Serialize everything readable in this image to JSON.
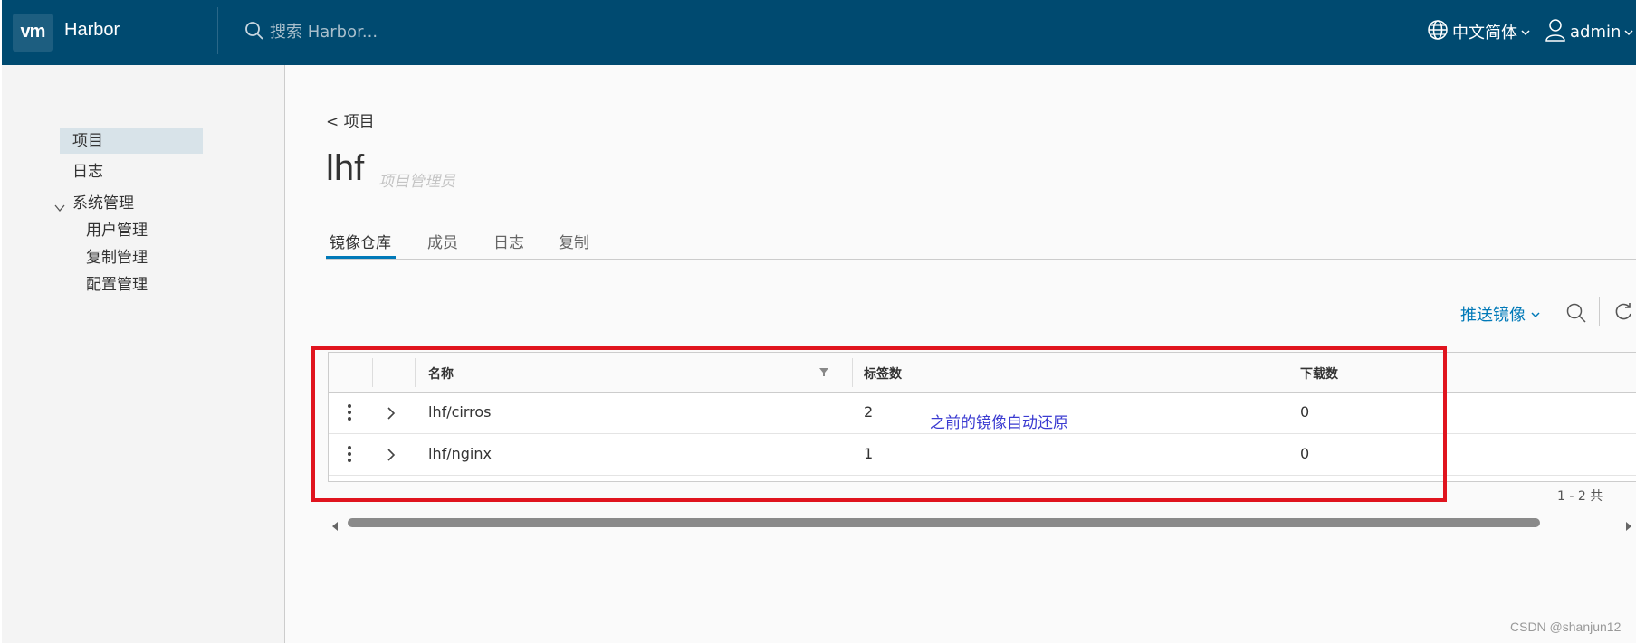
{
  "header": {
    "logo_text": "vm",
    "app_title": "Harbor",
    "search_placeholder": "搜索 Harbor...",
    "language": "中文简体",
    "user": "admin",
    "background_color": "#004a70"
  },
  "sidebar": {
    "items": [
      {
        "label": "项目",
        "active": true
      },
      {
        "label": "日志"
      },
      {
        "label": "系统管理",
        "expanded": true
      },
      {
        "label": "用户管理"
      },
      {
        "label": "复制管理"
      },
      {
        "label": "配置管理"
      }
    ]
  },
  "main": {
    "breadcrumb": "< 项目",
    "title": "lhf",
    "role": "项目管理员",
    "tabs": [
      {
        "label": "镜像仓库",
        "active": true
      },
      {
        "label": "成员"
      },
      {
        "label": "日志"
      },
      {
        "label": "复制"
      }
    ],
    "push_button": "推送镜像",
    "table": {
      "columns": [
        "名称",
        "标签数",
        "下载数"
      ],
      "rows": [
        {
          "name": "lhf/cirros",
          "tags": "2",
          "downloads": "0"
        },
        {
          "name": "lhf/nginx",
          "tags": "1",
          "downloads": "0"
        }
      ],
      "pagination": "1 - 2 共"
    }
  },
  "annotation": "之前的镜像自动还原",
  "watermark": "CSDN @shanjun12",
  "colors": {
    "accent": "#0079b8",
    "highlight_border": "#e0141e",
    "annotation_text": "#3b3bd1"
  }
}
